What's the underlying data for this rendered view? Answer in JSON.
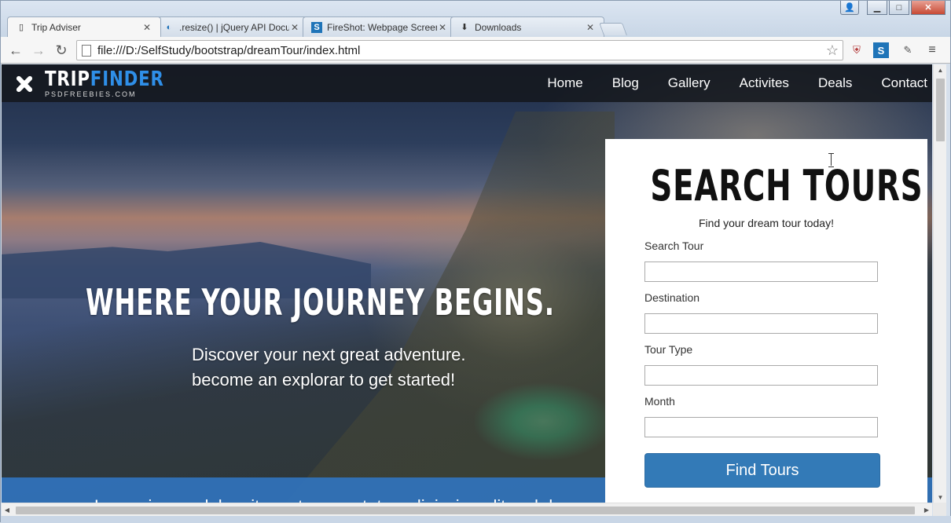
{
  "browser": {
    "tabs": [
      {
        "title": "Trip Adviser",
        "icon": "page-icon",
        "active": true
      },
      {
        "title": ".resize() | jQuery API Docu",
        "icon": "jquery-icon",
        "active": false
      },
      {
        "title": "FireShot: Webpage Screen",
        "icon": "fireshot-icon",
        "active": false
      },
      {
        "title": "Downloads",
        "icon": "download-icon",
        "active": false
      }
    ],
    "close_glyph": "✕",
    "url": "file:///D:/SelfStudy/bootstrap/dreamTour/index.html",
    "controls": {
      "minimize": "▁",
      "maximize": "□",
      "close": "✕",
      "user": "👤"
    }
  },
  "site": {
    "logo": {
      "title_a": "TRIP",
      "title_b": "FINDER",
      "sub": "PSDFREEBIES.COM",
      "accent_color": "#2f8fe8"
    },
    "menu": [
      "Home",
      "Blog",
      "Gallery",
      "Activites",
      "Deals",
      "Contact"
    ],
    "hero": {
      "heading": "WHERE YOUR JOURNEY BEGINS.",
      "sub_line1": "Discover your next great adventure.",
      "sub_line2": "become an explorar to get started!"
    },
    "band_text": "Lorem ipsum dolor sit amet consectetur adipiscing elit sed do"
  },
  "search": {
    "title": "SEARCH TOURS",
    "subtitle": "Find your dream tour today!",
    "fields": [
      {
        "label": "Search Tour",
        "value": ""
      },
      {
        "label": "Destination",
        "value": ""
      },
      {
        "label": "Tour Type",
        "value": ""
      },
      {
        "label": "Month",
        "value": ""
      }
    ],
    "button": "Find Tours",
    "button_color": "#337ab7"
  }
}
